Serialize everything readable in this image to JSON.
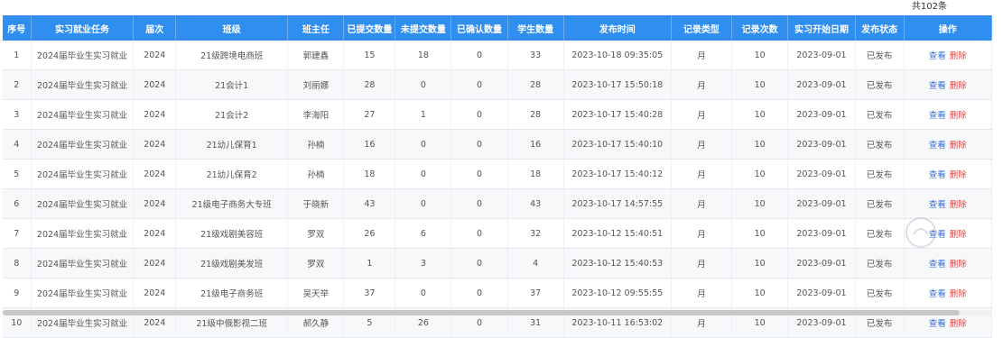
{
  "total_label": "共102条",
  "columns": [
    "序号",
    "实习就业任务",
    "届次",
    "班级",
    "班主任",
    "已提交数量",
    "未提交数量",
    "已确认数量",
    "学生数量",
    "发布时间",
    "记录类型",
    "记录次数",
    "实习开始日期",
    "发布状态",
    "操作"
  ],
  "actions": {
    "view": "查看",
    "delete": "删除"
  },
  "rows": [
    [
      "1",
      "2024届毕业生实习就业",
      "2024",
      "21级跨境电商班",
      "郭建鑫",
      "15",
      "18",
      "0",
      "33",
      "2023-10-18 09:35:05",
      "月",
      "10",
      "2023-09-01",
      "已发布"
    ],
    [
      "2",
      "2024届毕业生实习就业",
      "2024",
      "21会计1",
      "刘丽娜",
      "28",
      "0",
      "0",
      "28",
      "2023-10-17 15:50:18",
      "月",
      "10",
      "2023-09-01",
      "已发布"
    ],
    [
      "3",
      "2024届毕业生实习就业",
      "2024",
      "21会计2",
      "李海阳",
      "27",
      "1",
      "0",
      "28",
      "2023-10-17 15:40:28",
      "月",
      "10",
      "2023-09-01",
      "已发布"
    ],
    [
      "4",
      "2024届毕业生实习就业",
      "2024",
      "21幼儿保育1",
      "孙楠",
      "16",
      "0",
      "0",
      "16",
      "2023-10-17 15:40:10",
      "月",
      "10",
      "2023-09-01",
      "已发布"
    ],
    [
      "5",
      "2024届毕业生实习就业",
      "2024",
      "21幼儿保育2",
      "孙楠",
      "18",
      "0",
      "0",
      "18",
      "2023-10-17 15:40:12",
      "月",
      "10",
      "2023-09-01",
      "已发布"
    ],
    [
      "6",
      "2024届毕业生实习就业",
      "2024",
      "21级电子商务大专班",
      "于晓新",
      "43",
      "0",
      "0",
      "43",
      "2023-10-17 14:57:55",
      "月",
      "10",
      "2023-09-01",
      "已发布"
    ],
    [
      "7",
      "2024届毕业生实习就业",
      "2024",
      "21级戏剧美容班",
      "罗双",
      "26",
      "6",
      "0",
      "32",
      "2023-10-12 15:40:51",
      "月",
      "10",
      "2023-09-01",
      "已发布"
    ],
    [
      "8",
      "2024届毕业生实习就业",
      "2024",
      "21级戏剧美发班",
      "罗双",
      "1",
      "3",
      "0",
      "4",
      "2023-10-12 15:40:53",
      "月",
      "10",
      "2023-09-01",
      "已发布"
    ],
    [
      "9",
      "2024届毕业生实习就业",
      "2024",
      "21级电子商务班",
      "吴天举",
      "37",
      "0",
      "0",
      "37",
      "2023-10-12 09:55:55",
      "月",
      "10",
      "2023-09-01",
      "已发布"
    ],
    [
      "10",
      "2024届毕业生实习就业",
      "2024",
      "21级中俄影视二班",
      "郝久静",
      "5",
      "26",
      "0",
      "31",
      "2023-10-11 16:53:02",
      "月",
      "10",
      "2023-09-01",
      "已发布"
    ]
  ]
}
